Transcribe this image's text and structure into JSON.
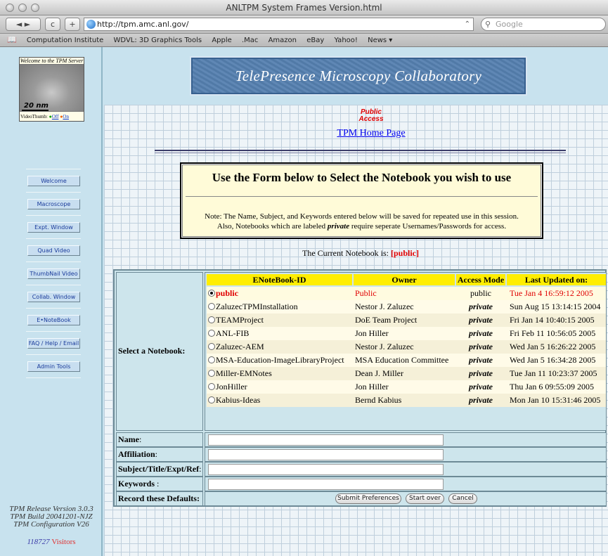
{
  "window": {
    "title": "ANLTPM System Frames Version.html"
  },
  "toolbar": {
    "back_forward": "◄ ►",
    "reload": "c",
    "add": "+",
    "url": "http://tpm.amc.anl.gov/",
    "search_placeholder": "Google"
  },
  "bookmarks": [
    "Computation Institute",
    "WDVL: 3D Graphics Tools",
    "Apple",
    ".Mac",
    "Amazon",
    "eBay",
    "Yahoo!",
    "News ▾"
  ],
  "left": {
    "thumb_caption": "Welcome to the TPM Server",
    "scale_label": "20 nm",
    "videothumb_label": "VideoThumb:",
    "off_label": "Off",
    "on_label": "On",
    "nav": [
      {
        "label": "Welcome"
      },
      {
        "label": "Macroscope"
      },
      {
        "label": "Expt. Window"
      },
      {
        "label": "Quad Video"
      },
      {
        "label": "ThumbNail Video"
      },
      {
        "label": "Collab. Window"
      },
      {
        "label": "E•NoteBook"
      },
      {
        "label": "FAQ / Help / Email"
      },
      {
        "label": "Admin Tools"
      }
    ],
    "release_lines": [
      "TPM Release Version 3.0.3",
      "TPM Build 20041201-NJZ",
      "TPM Configuration V26"
    ],
    "visitor_count": "118727",
    "visitors_label": "Visitors"
  },
  "main": {
    "banner": "TelePresence Microscopy Collaboratory",
    "public_label": "Public",
    "access_label": "Access",
    "home_link": "TPM Home Page",
    "select_heading": "Use the Form below to Select the Notebook you wish to use",
    "note_line1": "Note: The Name, Subject, and Keywords entered below will be saved for repeated use in this session.",
    "note_line2a": "Also, Notebooks which are labeled",
    "note_line2_private": "private",
    "note_line2b": "require seperate Usernames/Passwords for access.",
    "current_prefix": "The Current Notebook is:",
    "current_value": "[public]",
    "select_label": "Select a Notebook:",
    "columns": [
      "ENoteBook-ID",
      "Owner",
      "Access Mode",
      "Last Updated on:"
    ],
    "notebooks": [
      {
        "id": "public",
        "owner": "Public",
        "mode": "public",
        "updated": "Tue Jan 4 16:59:12 2005",
        "selected": true
      },
      {
        "id": "ZaluzecTPMInstallation",
        "owner": "Nestor J. Zaluzec",
        "mode": "private",
        "updated": "Sun Aug 15 13:14:15 2004",
        "selected": false
      },
      {
        "id": "TEAMProject",
        "owner": "DoE Team Project",
        "mode": "private",
        "updated": "Fri Jan 14 10:40:15 2005",
        "selected": false
      },
      {
        "id": "ANL-FIB",
        "owner": "Jon Hiller",
        "mode": "private",
        "updated": "Fri Feb 11 10:56:05 2005",
        "selected": false
      },
      {
        "id": "Zaluzec-AEM",
        "owner": "Nestor J. Zaluzec",
        "mode": "private",
        "updated": "Wed Jan 5 16:26:22 2005",
        "selected": false
      },
      {
        "id": "MSA-Education-ImageLibraryProject",
        "owner": "MSA Education Committee",
        "mode": "private",
        "updated": "Wed Jan 5 16:34:28 2005",
        "selected": false
      },
      {
        "id": "Miller-EMNotes",
        "owner": "Dean J. Miller",
        "mode": "private",
        "updated": "Tue Jan 11 10:23:37 2005",
        "selected": false
      },
      {
        "id": "JonHiller",
        "owner": "Jon Hiller",
        "mode": "private",
        "updated": "Thu Jan 6 09:55:09 2005",
        "selected": false
      },
      {
        "id": "Kabius-Ideas",
        "owner": "Bernd Kabius",
        "mode": "private",
        "updated": "Mon Jan 10 15:31:46 2005",
        "selected": false
      }
    ],
    "form": {
      "name_label": "Name",
      "affiliation_label": "Affiliation",
      "subject_label": "Subject/Title/Expt/Ref",
      "keywords_label": "Keywords",
      "defaults_label": "Record these Defaults:",
      "name_value": "",
      "affiliation_value": "",
      "subject_value": "",
      "keywords_value": ""
    },
    "buttons": {
      "submit": "Submit Preferences",
      "start_over": "Start over",
      "cancel": "Cancel"
    }
  }
}
